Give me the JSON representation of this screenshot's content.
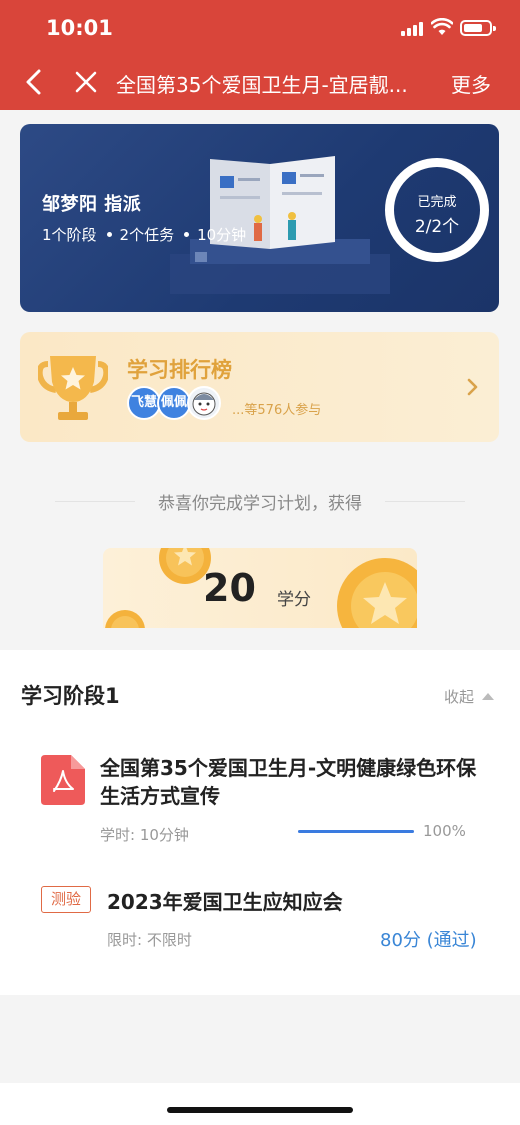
{
  "status_bar": {
    "time": "10:01"
  },
  "nav": {
    "title": "全国第35个爱国卫生月-宜居靓...",
    "more_label": "更多"
  },
  "banner": {
    "assigner": "邹梦阳  指派",
    "stages": "1个阶段",
    "tasks": "2个任务",
    "duration": "10分钟",
    "completed_label": "已完成",
    "completed_value": "2/2个"
  },
  "ranking": {
    "title": "学习排行榜",
    "avatars": [
      "飞慧",
      "佩佩",
      ""
    ],
    "participants": "...等576人参与"
  },
  "congrats": {
    "text": "恭喜你完成学习计划，获得",
    "credits": "20",
    "credits_unit": "学分"
  },
  "stage": {
    "title": "学习阶段1",
    "collapse_label": "收起",
    "items": [
      {
        "title": "全国第35个爱国卫生月-文明健康绿色环保生活方式宣传",
        "study_time": "学时: 10分钟",
        "progress_text": "100%",
        "progress": 1.0
      },
      {
        "tag": "测验",
        "title": "2023年爱国卫生应知应会",
        "time_limit": "限时: 不限时",
        "score": "80分 (通过)"
      }
    ]
  },
  "colors": {
    "header": "#d9453a",
    "banner": "#1e3a72",
    "accent_gold": "#e0a23c",
    "link_blue": "#3a86d6"
  }
}
